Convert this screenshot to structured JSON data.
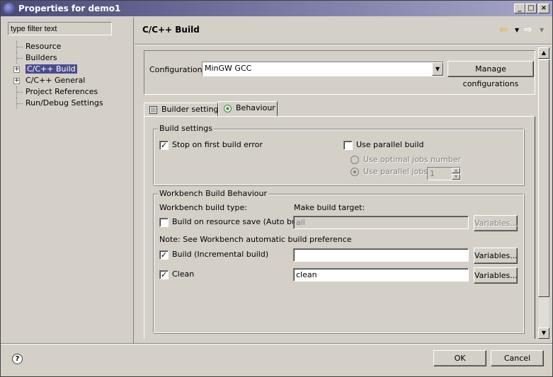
{
  "window": {
    "title": "Properties for demo1"
  },
  "left": {
    "filter_placeholder": "type filter text",
    "tree": [
      {
        "label": "Resource",
        "expandable": false
      },
      {
        "label": "Builders",
        "expandable": false
      },
      {
        "label": "C/C++ Build",
        "expandable": true,
        "selected": true
      },
      {
        "label": "C/C++ General",
        "expandable": true
      },
      {
        "label": "Project References",
        "expandable": false
      },
      {
        "label": "Run/Debug Settings",
        "expandable": false
      }
    ]
  },
  "page": {
    "title": "C/C++ Build",
    "configuration_label": "Configuration:",
    "configuration_value": "MinGW GCC",
    "manage_button": "Manage configurations",
    "tabs": [
      "Builder settings",
      "Behaviour"
    ],
    "active_tab": "Behaviour"
  },
  "build_settings": {
    "group_title": "Build settings",
    "stop_on_first_error": {
      "label": "Stop on first build error",
      "checked": true
    },
    "parallel_build": {
      "label": "Use parallel build",
      "checked": false
    },
    "optimal_jobs": {
      "label": "Use optimal jobs number"
    },
    "parallel_jobs": {
      "label": "Use parallel jobs:",
      "value": "1"
    }
  },
  "workbench": {
    "group_title": "Workbench Build Behaviour",
    "build_type_label": "Workbench build type:",
    "target_label": "Make build target:",
    "auto_build": {
      "label": "Build on resource save (Auto build)",
      "checked": false,
      "target": "all",
      "button": "Variables..."
    },
    "note": "Note: See Workbench automatic build preference",
    "incremental": {
      "label": "Build (Incremental build)",
      "checked": true,
      "target": "",
      "button": "Variables..."
    },
    "clean": {
      "label": "Clean",
      "checked": true,
      "target": "clean",
      "button": "Variables..."
    }
  },
  "footer": {
    "ok": "OK",
    "cancel": "Cancel"
  }
}
